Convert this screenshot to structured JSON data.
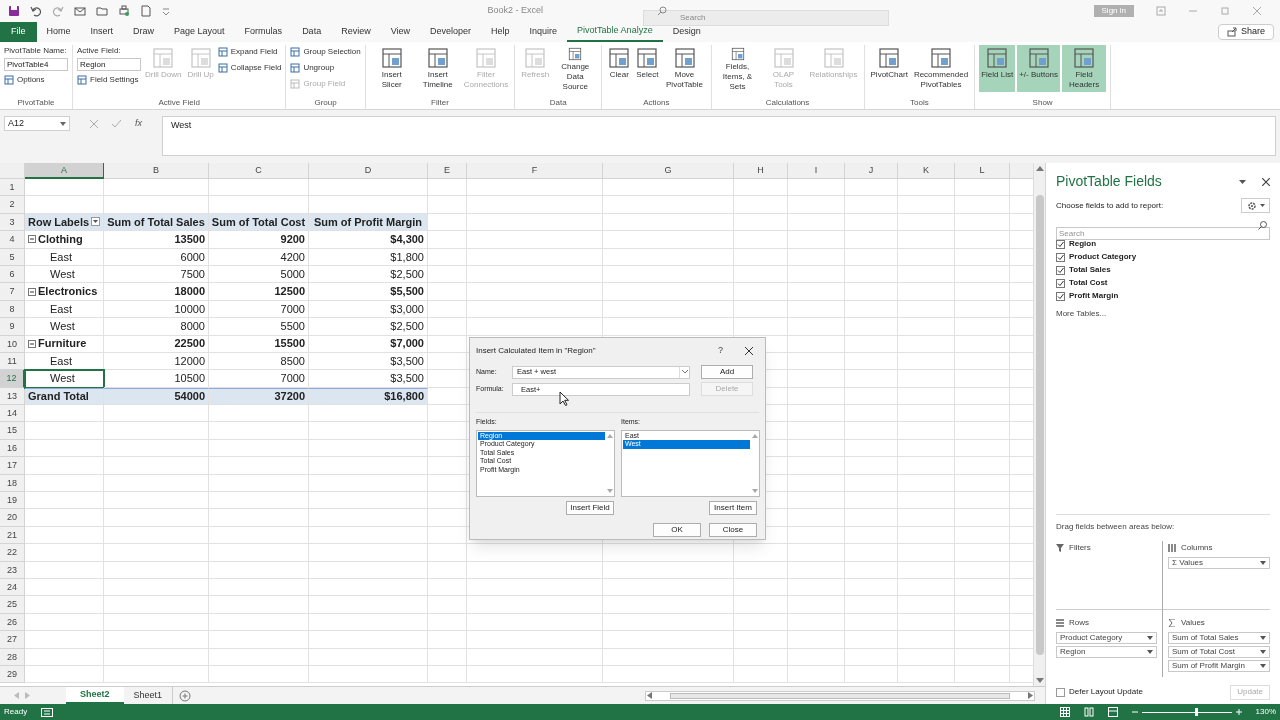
{
  "title_bar": {
    "title": "Book2 - Excel",
    "search_placeholder": "Search",
    "sign_in": "Sign in"
  },
  "ribbon_tabs": [
    {
      "label": "File",
      "kind": "file",
      "selected": false
    },
    {
      "label": "Home",
      "kind": "tab",
      "selected": false
    },
    {
      "label": "Insert",
      "kind": "tab",
      "selected": false
    },
    {
      "label": "Draw",
      "kind": "tab",
      "selected": false
    },
    {
      "label": "Page Layout",
      "kind": "tab",
      "selected": false
    },
    {
      "label": "Formulas",
      "kind": "tab",
      "selected": false
    },
    {
      "label": "Data",
      "kind": "tab",
      "selected": false
    },
    {
      "label": "Review",
      "kind": "tab",
      "selected": false
    },
    {
      "label": "View",
      "kind": "tab",
      "selected": false
    },
    {
      "label": "Developer",
      "kind": "tab",
      "selected": false
    },
    {
      "label": "Help",
      "kind": "tab",
      "selected": false
    },
    {
      "label": "Inquire",
      "kind": "tab",
      "selected": false
    },
    {
      "label": "PivotTable Analyze",
      "kind": "tab",
      "selected": true
    },
    {
      "label": "Design",
      "kind": "tab",
      "selected": false
    }
  ],
  "share": "Share",
  "ribbon_groups": [
    {
      "label": "PivotTable",
      "columns": [
        [
          {
            "kind": "label",
            "text": "PivotTable Name:"
          },
          {
            "kind": "input",
            "text": "PivotTable4"
          },
          {
            "kind": "small",
            "text": "Options",
            "disabled": false
          }
        ]
      ]
    },
    {
      "label": "Active Field",
      "columns": [
        [
          {
            "kind": "label",
            "text": "Active Field:"
          },
          {
            "kind": "input",
            "text": "Region"
          },
          {
            "kind": "small",
            "text": "Field Settings",
            "disabled": false
          }
        ],
        [
          {
            "kind": "large",
            "text": "Drill Down",
            "disabled": true,
            "selected": false
          }
        ],
        [
          {
            "kind": "large",
            "text": "Drill Up",
            "disabled": true,
            "selected": false
          }
        ],
        [
          {
            "kind": "small",
            "text": "Expand Field",
            "disabled": false
          },
          {
            "kind": "small",
            "text": "Collapse Field",
            "disabled": false
          }
        ]
      ]
    },
    {
      "label": "Group",
      "columns": [
        [
          {
            "kind": "small",
            "text": "Group Selection",
            "disabled": false
          },
          {
            "kind": "small",
            "text": "Ungroup",
            "disabled": false
          },
          {
            "kind": "small",
            "text": "Group Field",
            "disabled": true
          }
        ]
      ]
    },
    {
      "label": "Filter",
      "columns": [
        [
          {
            "kind": "large",
            "text": "Insert Slicer",
            "disabled": false,
            "selected": false
          }
        ],
        [
          {
            "kind": "large",
            "text": "Insert Timeline",
            "disabled": false,
            "selected": false
          }
        ],
        [
          {
            "kind": "large",
            "text": "Filter Connections",
            "disabled": true,
            "selected": false
          }
        ]
      ]
    },
    {
      "label": "Data",
      "columns": [
        [
          {
            "kind": "large",
            "text": "Refresh",
            "disabled": true,
            "selected": false
          }
        ],
        [
          {
            "kind": "large",
            "text": "Change Data Source",
            "disabled": false,
            "selected": false
          }
        ]
      ]
    },
    {
      "label": "Actions",
      "columns": [
        [
          {
            "kind": "large",
            "text": "Clear",
            "disabled": false,
            "selected": false
          }
        ],
        [
          {
            "kind": "large",
            "text": "Select",
            "disabled": false,
            "selected": false
          }
        ],
        [
          {
            "kind": "large",
            "text": "Move PivotTable",
            "disabled": false,
            "selected": false
          }
        ]
      ]
    },
    {
      "label": "Calculations",
      "columns": [
        [
          {
            "kind": "large",
            "text": "Fields, Items, & Sets",
            "disabled": false,
            "selected": false
          }
        ],
        [
          {
            "kind": "large",
            "text": "OLAP Tools",
            "disabled": true,
            "selected": false
          }
        ],
        [
          {
            "kind": "large",
            "text": "Relationships",
            "disabled": true,
            "selected": false
          }
        ]
      ]
    },
    {
      "label": "Tools",
      "columns": [
        [
          {
            "kind": "large",
            "text": "PivotChart",
            "disabled": false,
            "selected": false
          }
        ],
        [
          {
            "kind": "large",
            "text": "Recommended PivotTables",
            "disabled": false,
            "selected": false
          }
        ]
      ]
    },
    {
      "label": "Show",
      "columns": [
        [
          {
            "kind": "large",
            "text": "Field List",
            "disabled": false,
            "selected": true
          }
        ],
        [
          {
            "kind": "large",
            "text": "+/- Buttons",
            "disabled": false,
            "selected": true
          }
        ],
        [
          {
            "kind": "large",
            "text": "Field Headers",
            "disabled": false,
            "selected": true
          }
        ]
      ]
    }
  ],
  "formula_bar": {
    "name_box": "A12",
    "fx": "fx",
    "value": "West"
  },
  "columns": [
    {
      "label": "A",
      "selected": true
    },
    {
      "label": "B",
      "selected": false
    },
    {
      "label": "C",
      "selected": false
    },
    {
      "label": "D",
      "selected": false
    },
    {
      "label": "E",
      "selected": false
    },
    {
      "label": "F",
      "selected": false
    },
    {
      "label": "G",
      "selected": false
    },
    {
      "label": "H",
      "selected": false
    },
    {
      "label": "I",
      "selected": false
    },
    {
      "label": "J",
      "selected": false
    },
    {
      "label": "K",
      "selected": false
    },
    {
      "label": "L",
      "selected": false
    }
  ],
  "rows": [
    {
      "number": "1",
      "kind": "empty",
      "selected": false
    },
    {
      "number": "2",
      "kind": "empty",
      "selected": false
    },
    {
      "number": "3",
      "kind": "header",
      "selected": false,
      "cells": [
        "Row Labels",
        "Sum of Total Sales",
        "Sum of Total Cost",
        "Sum of Profit Margin"
      ]
    },
    {
      "number": "4",
      "kind": "category",
      "expanded": true,
      "selected": false,
      "cells": [
        "Clothing",
        "13500",
        "9200",
        "$4,300"
      ]
    },
    {
      "number": "5",
      "kind": "item",
      "selected": false,
      "cells": [
        "East",
        "6000",
        "4200",
        "$1,800"
      ]
    },
    {
      "number": "6",
      "kind": "item",
      "selected": false,
      "cells": [
        "West",
        "7500",
        "5000",
        "$2,500"
      ]
    },
    {
      "number": "7",
      "kind": "category",
      "expanded": true,
      "selected": false,
      "cells": [
        "Electronics",
        "18000",
        "12500",
        "$5,500"
      ]
    },
    {
      "number": "8",
      "kind": "item",
      "selected": false,
      "cells": [
        "East",
        "10000",
        "7000",
        "$3,000"
      ]
    },
    {
      "number": "9",
      "kind": "item",
      "selected": false,
      "cells": [
        "West",
        "8000",
        "5500",
        "$2,500"
      ]
    },
    {
      "number": "10",
      "kind": "category",
      "expanded": true,
      "selected": false,
      "cells": [
        "Furniture",
        "22500",
        "15500",
        "$7,000"
      ]
    },
    {
      "number": "11",
      "kind": "item",
      "selected": false,
      "cells": [
        "East",
        "12000",
        "8500",
        "$3,500"
      ]
    },
    {
      "number": "12",
      "kind": "item",
      "selected": true,
      "cells": [
        "West",
        "10500",
        "7000",
        "$3,500"
      ]
    },
    {
      "number": "13",
      "kind": "total",
      "selected": false,
      "cells": [
        "Grand Total",
        "54000",
        "37200",
        "$16,800"
      ]
    },
    {
      "number": "14",
      "kind": "empty",
      "selected": false
    },
    {
      "number": "15",
      "kind": "empty",
      "selected": false
    },
    {
      "number": "16",
      "kind": "empty",
      "selected": false
    },
    {
      "number": "17",
      "kind": "empty",
      "selected": false
    },
    {
      "number": "18",
      "kind": "empty",
      "selected": false
    },
    {
      "number": "19",
      "kind": "empty",
      "selected": false
    },
    {
      "number": "20",
      "kind": "empty",
      "selected": false
    },
    {
      "number": "21",
      "kind": "empty",
      "selected": false
    },
    {
      "number": "22",
      "kind": "empty",
      "selected": false
    },
    {
      "number": "23",
      "kind": "empty",
      "selected": false
    },
    {
      "number": "24",
      "kind": "empty",
      "selected": false
    },
    {
      "number": "25",
      "kind": "empty",
      "selected": false
    },
    {
      "number": "26",
      "kind": "empty",
      "selected": false
    },
    {
      "number": "27",
      "kind": "empty",
      "selected": false
    },
    {
      "number": "28",
      "kind": "empty",
      "selected": false
    },
    {
      "number": "29",
      "kind": "empty",
      "selected": false
    }
  ],
  "sheet_tabs": [
    {
      "label": "Sheet2",
      "selected": true
    },
    {
      "label": "Sheet1",
      "selected": false
    }
  ],
  "status_bar": {
    "text": "Ready",
    "zoom": "130%",
    "zoom_slider": {
      "level": 0.62
    }
  },
  "pane": {
    "title": "PivotTable Fields",
    "subtitle": "Choose fields to add to report:",
    "search_placeholder": "Search",
    "fields": [
      {
        "label": "Region",
        "checked": true
      },
      {
        "label": "Product Category",
        "checked": true
      },
      {
        "label": "Total Sales",
        "checked": true
      },
      {
        "label": "Total Cost",
        "checked": true
      },
      {
        "label": "Profit Margin",
        "checked": true
      }
    ],
    "more_tables": "More Tables...",
    "drag_hint": "Drag fields between areas below:",
    "areas": [
      {
        "label": "Filters",
        "kind": "filters"
      },
      {
        "label": "Columns",
        "kind": "columns",
        "items": [
          "Σ Values"
        ]
      },
      {
        "label": "Rows",
        "kind": "rows",
        "items": [
          "Product Category",
          "Region"
        ]
      },
      {
        "label": "Values",
        "kind": "values",
        "items": [
          "Sum of Total Sales",
          "Sum of Total Cost",
          "Sum of Profit Margin"
        ]
      }
    ],
    "defer": {
      "label": "Defer Layout Update",
      "checked": false
    },
    "update": {
      "label": "Update",
      "disabled": true
    }
  },
  "dialog": {
    "title": "Insert Calculated Item in \"Region\"",
    "help": "?",
    "name_label": "Name:",
    "name_value": "East + west",
    "formula_label": "Formula:",
    "formula_value": "East+",
    "add": {
      "label": "Add",
      "disabled": false
    },
    "delete": {
      "label": "Delete",
      "disabled": true
    },
    "fields_label": "Fields:",
    "fields": [
      {
        "label": "Region",
        "selected": true
      },
      {
        "label": "Product Category",
        "selected": false
      },
      {
        "label": "Total Sales",
        "selected": false
      },
      {
        "label": "Total Cost",
        "selected": false
      },
      {
        "label": "Profit Margin",
        "selected": false
      }
    ],
    "items_label": "Items:",
    "items": [
      {
        "label": "East",
        "selected": false
      },
      {
        "label": "West",
        "selected": true
      }
    ],
    "insert_field": "Insert Field",
    "insert_item": "Insert Item",
    "ok": "OK",
    "close": "Close"
  }
}
